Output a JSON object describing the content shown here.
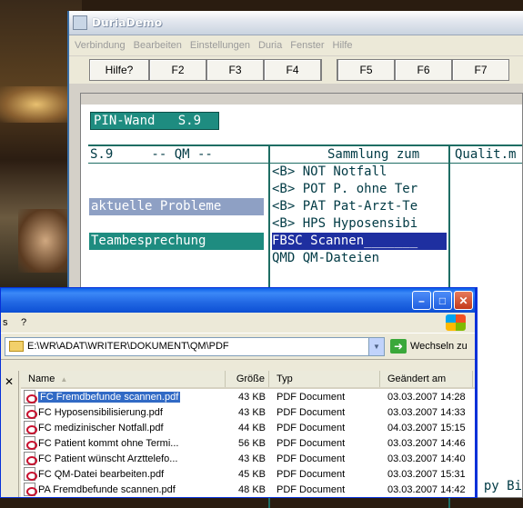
{
  "duria": {
    "title": "DuriaDemo",
    "menu": [
      "Verbindung",
      "Bearbeiten",
      "Einstellungen",
      "Duria",
      "Fenster",
      "Hilfe"
    ],
    "fkeys": {
      "help": "Hilfe",
      "keys": [
        "F2",
        "F3",
        "F4",
        "F5",
        "F6",
        "F7"
      ]
    },
    "terminal": {
      "pin_label": "PIN-Wand   S.9",
      "col1_header": "S.9     -- QM --",
      "col2_header": "Sammlung zum",
      "col3_header": "Qualit.m",
      "left_items": [
        "aktuelle Probleme",
        "Teambesprechung"
      ],
      "list_items": [
        "<B> NOT Notfall",
        "<B> POT P. ohne Ter",
        "<B> PAT Pat-Arzt-Te",
        "<B> HPS Hyposensibi",
        "FBSC Scannen_______",
        "QMD QM-Dateien"
      ],
      "bottom_text": "py Bi"
    }
  },
  "explorer": {
    "menu_fragment": "s",
    "menu_help": "?",
    "address": "E:\\WR\\ADAT\\WRITER\\DOKUMENT\\QM\\PDF",
    "go_label": "Wechseln zu",
    "columns": [
      "Name",
      "Größe",
      "Typ",
      "Geändert am"
    ],
    "files": [
      {
        "name": "FC Fremdbefunde scannen.pdf",
        "size": "43 KB",
        "type": "PDF Document",
        "date": "03.03.2007 14:28"
      },
      {
        "name": "FC Hyposensibilisierung.pdf",
        "size": "43 KB",
        "type": "PDF Document",
        "date": "03.03.2007 14:33"
      },
      {
        "name": "FC medizinischer Notfall.pdf",
        "size": "44 KB",
        "type": "PDF Document",
        "date": "04.03.2007 15:15"
      },
      {
        "name": "FC Patient kommt ohne Termi...",
        "size": "56 KB",
        "type": "PDF Document",
        "date": "03.03.2007 14:46"
      },
      {
        "name": "FC Patient wünscht Arzttelefo...",
        "size": "43 KB",
        "type": "PDF Document",
        "date": "03.03.2007 14:40"
      },
      {
        "name": "FC QM-Datei bearbeiten.pdf",
        "size": "45 KB",
        "type": "PDF Document",
        "date": "03.03.2007 15:31"
      },
      {
        "name": "PA Fremdbefunde scannen.pdf",
        "size": "48 KB",
        "type": "PDF Document",
        "date": "03.03.2007 14:42"
      }
    ]
  }
}
